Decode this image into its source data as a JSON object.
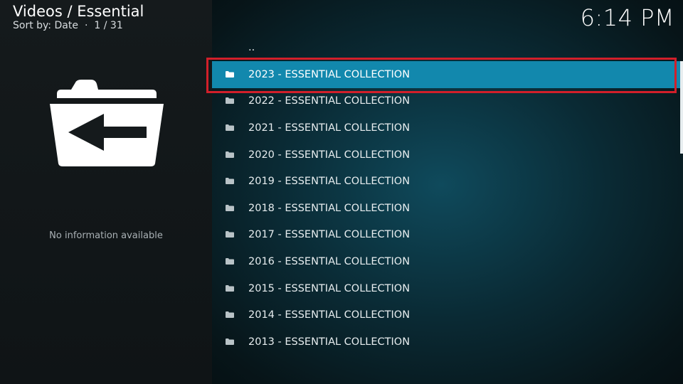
{
  "header": {
    "title": "Videos / Essential",
    "sort_label": "Sort by: Date",
    "separator": "·",
    "position": "1 / 31"
  },
  "clock": "6:14 PM",
  "info_panel": {
    "icon": "folder-back-icon",
    "message": "No information available"
  },
  "list": {
    "parent": "..",
    "items": [
      {
        "label": "2023 - ESSENTIAL COLLECTION",
        "selected": true
      },
      {
        "label": "2022 - ESSENTIAL COLLECTION"
      },
      {
        "label": "2021 - ESSENTIAL COLLECTION"
      },
      {
        "label": "2020 - ESSENTIAL COLLECTION"
      },
      {
        "label": "2019 - ESSENTIAL COLLECTION"
      },
      {
        "label": "2018 - ESSENTIAL COLLECTION"
      },
      {
        "label": "2017 - ESSENTIAL COLLECTION"
      },
      {
        "label": "2016 - ESSENTIAL COLLECTION"
      },
      {
        "label": "2015 - ESSENTIAL COLLECTION"
      },
      {
        "label": "2014 - ESSENTIAL COLLECTION"
      },
      {
        "label": "2013 - ESSENTIAL COLLECTION"
      }
    ]
  },
  "colors": {
    "selected_row": "#1288ad",
    "highlight_border": "#d21f2a"
  }
}
